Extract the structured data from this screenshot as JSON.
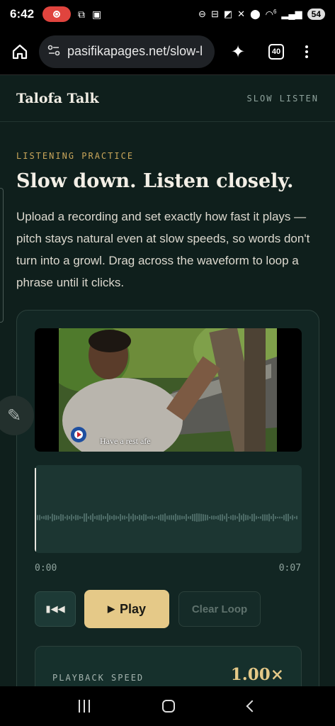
{
  "status_bar": {
    "time": "6:42",
    "battery": "54",
    "signal_label": "6"
  },
  "browser": {
    "url": "pasifikapages.net/slow-l",
    "tab_count": "40",
    "icons": [
      "home-icon",
      "site-settings-icon",
      "sparkle-icon",
      "tabs-icon",
      "more-icon"
    ]
  },
  "site": {
    "brand": "Talofa Talk",
    "nav_link": "SLOW LISTEN"
  },
  "hero": {
    "eyebrow": "LISTENING PRACTICE",
    "title": "Slow down. Listen closely.",
    "description": "Upload a recording and set exactly how fast it plays — pitch stays natural even at slow speeds, so words don't turn into a growl. Drag across the waveform to loop a phrase until it clicks."
  },
  "player": {
    "video_caption": "Have a rest afe",
    "time_start": "0:00",
    "time_end": "0:07",
    "rewind_icon": "skip-back-icon",
    "play_label": "Play",
    "play_glyph": "▶",
    "clear_loop_label": "Clear Loop",
    "speed_label": "PLAYBACK SPEED",
    "speed_value": "1.00×"
  },
  "colors": {
    "background": "#0f1f1c",
    "accent": "#e5c988",
    "eyebrow": "#c9a65a",
    "panel": "#122623"
  }
}
